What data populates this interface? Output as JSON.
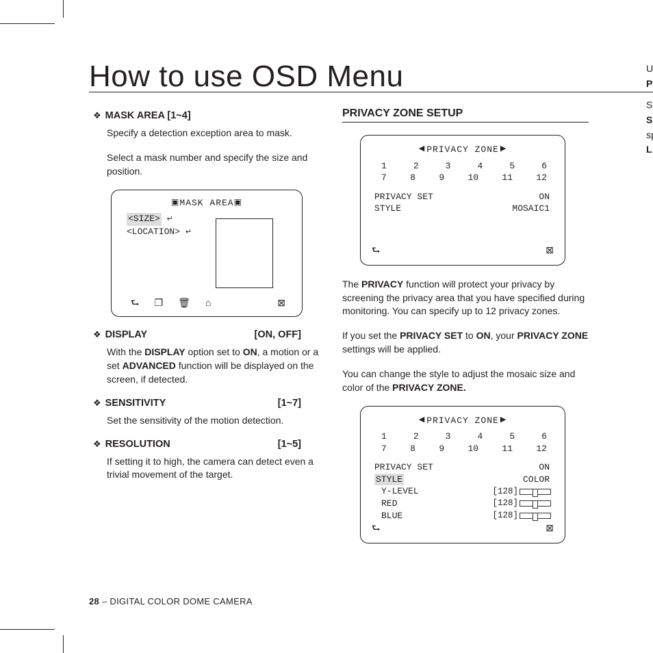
{
  "page": {
    "title": "How to use OSD Menu",
    "footer_page": "28",
    "footer_sep": " – ",
    "footer_text": "DIGITAL COLOR DOME CAMERA"
  },
  "col_extra": {
    "l1": "U",
    "l2": "P",
    "l3": "S",
    "l4": "S",
    "l5": "sp",
    "l6": "L"
  },
  "mask_area": {
    "head": "MASK AREA   [1~4]",
    "p1": "Specify a detection exception area to mask.",
    "p2": "Select a mask number and specify the size and position.",
    "osd_title": "MASK AREA",
    "label_size": "<SIZE>",
    "label_loc": "<LOCATION>"
  },
  "display": {
    "head": "DISPLAY",
    "val": "[ON, OFF]",
    "p": "With the DISPLAY option set to ON, a motion or a set ADVANCED function will be displayed on the screen, if detected.",
    "b1": "DISPLAY",
    "b2": "ON",
    "b3": "ADVANCED"
  },
  "sensitivity": {
    "head": "SENSITIVITY",
    "val": "[1~7]",
    "p": "Set the sensitivity of the motion detection."
  },
  "resolution": {
    "head": "RESOLUTION",
    "val": "[1~5]",
    "p": "If setting it to high, the camera can detect even a trivial movement of the target."
  },
  "privacy": {
    "section": "PRIVACY ZONE SETUP",
    "osd_title": "PRIVACY ZONE",
    "nums_a": [
      "1",
      "2",
      "3",
      "4",
      "5",
      "6"
    ],
    "nums_b": [
      "7",
      "8",
      "9",
      "10",
      "11",
      "12"
    ],
    "row1_k": "PRIVACY SET",
    "row1_v": "ON",
    "row2_k": "STYLE",
    "row2_v": "MOSAIC1",
    "p1a": "The ",
    "p1b": "PRIVACY",
    "p1c": " function will protect your privacy by screening the privacy area that you have specified during monitoring. You can specify up to 12 privacy zones.",
    "p2a": "If you set the ",
    "p2b": "PRIVACY SET",
    "p2c": " to ",
    "p2d": "ON",
    "p2e": ", your ",
    "p2f": "PRIVACY ZONE",
    "p2g": " settings will be applied.",
    "p3a": "You can change the style to adjust the mosaic size and color of the ",
    "p3b": "PRIVACY ZONE.",
    "box2_row1_k": "PRIVACY SET",
    "box2_row1_v": "ON",
    "box2_row2_k": "STYLE",
    "box2_row2_v": "COLOR",
    "box2_y": "Y-LEVEL",
    "box2_y_v": "[128]",
    "box2_r": "RED",
    "box2_r_v": "[128]",
    "box2_b": "BLUE",
    "box2_b_v": "[128]"
  }
}
